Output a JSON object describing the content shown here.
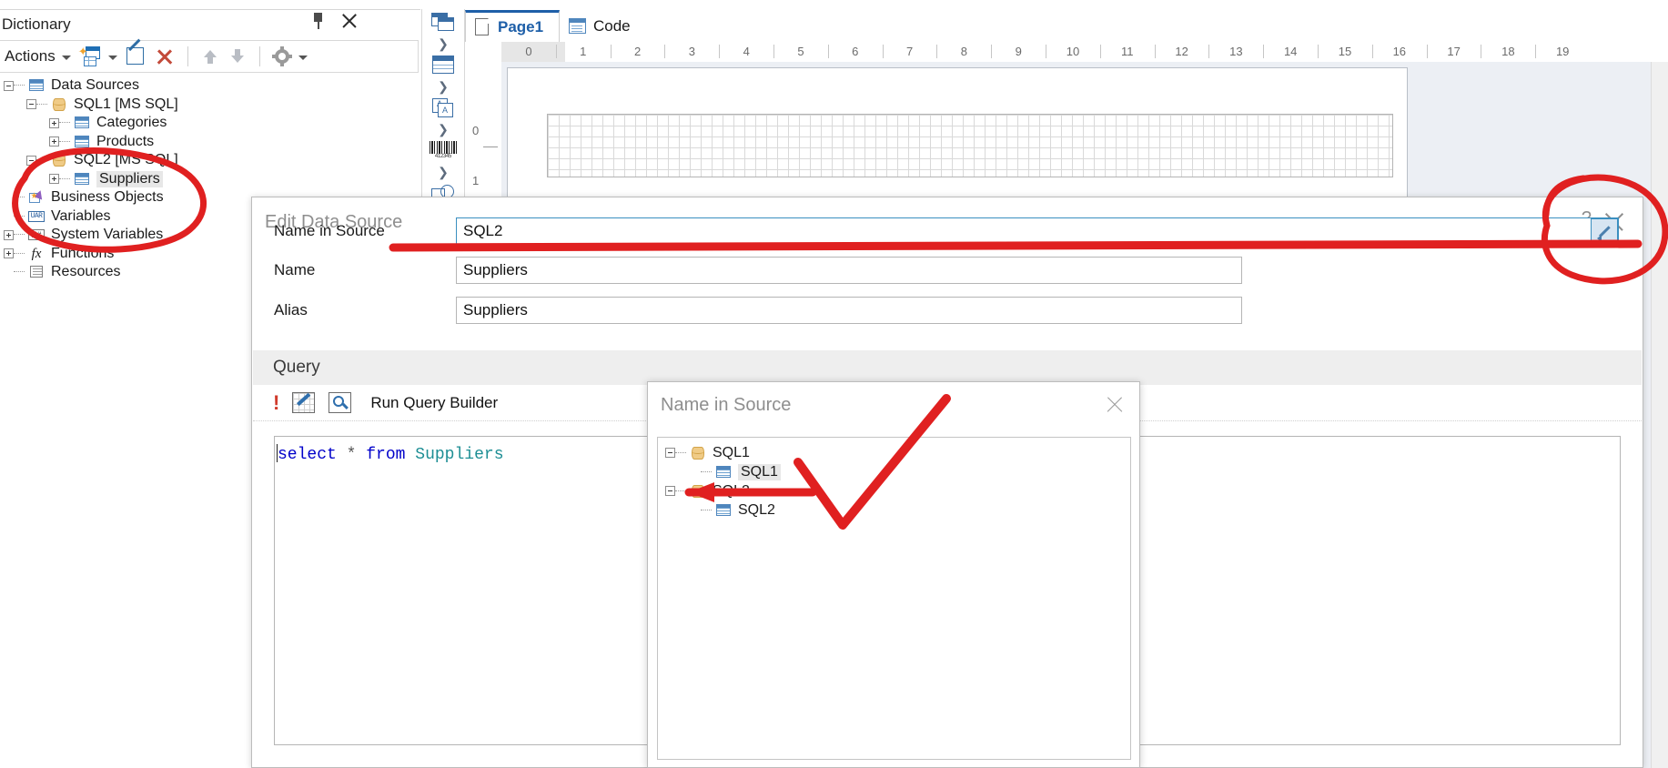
{
  "dictionary": {
    "title": "Dictionary",
    "pin_icon": "pin-icon",
    "close_icon": "close-icon",
    "toolbar": {
      "actions_label": "Actions",
      "new_item_icon": "new-data-source-icon",
      "edit_icon": "edit-icon",
      "delete_icon": "delete-icon",
      "move_up_icon": "arrow-up-icon",
      "move_down_icon": "arrow-down-icon",
      "settings_icon": "gear-icon"
    },
    "tree": [
      {
        "label": "Data Sources",
        "indent": 0,
        "expander": "minus",
        "icon": "table-icon",
        "selected": false
      },
      {
        "label": "SQL1 [MS SQL]",
        "indent": 1,
        "expander": "minus",
        "icon": "database-icon",
        "selected": false
      },
      {
        "label": "Categories",
        "indent": 2,
        "expander": "plus",
        "icon": "table-icon",
        "selected": false
      },
      {
        "label": "Products",
        "indent": 2,
        "expander": "plus",
        "icon": "table-icon",
        "selected": false
      },
      {
        "label": "SQL2 [MS SQL]",
        "indent": 1,
        "expander": "minus",
        "icon": "database-icon",
        "selected": false
      },
      {
        "label": "Suppliers",
        "indent": 2,
        "expander": "plus",
        "icon": "table-icon",
        "selected": true
      },
      {
        "label": "Business Objects",
        "indent": 0,
        "expander": "none",
        "icon": "business-objects-icon",
        "selected": false
      },
      {
        "label": "Variables",
        "indent": 0,
        "expander": "none",
        "icon": "variables-icon",
        "selected": false
      },
      {
        "label": "System Variables",
        "indent": 0,
        "expander": "plus",
        "icon": "system-variables-icon",
        "selected": false
      },
      {
        "label": "Functions",
        "indent": 0,
        "expander": "plus",
        "icon": "functions-icon",
        "selected": false
      },
      {
        "label": "Resources",
        "indent": 0,
        "expander": "none",
        "icon": "resources-icon",
        "selected": false
      }
    ]
  },
  "component_strip": {
    "items": [
      {
        "icon": "panels-icon",
        "chevron": "chevron-right-icon"
      },
      {
        "icon": "data-band-icon",
        "chevron": "chevron-right-icon"
      },
      {
        "icon": "text-icon",
        "chevron": "chevron-right-icon"
      },
      {
        "icon": "barcode-icon",
        "chevron": "chevron-right-icon"
      },
      {
        "icon": "shapes-icon",
        "chevron": ""
      }
    ]
  },
  "tabs": [
    {
      "label": "Page1",
      "icon": "page-icon",
      "active": true
    },
    {
      "label": "Code",
      "icon": "code-icon",
      "active": false
    }
  ],
  "ruler": {
    "horizontal": [
      "0",
      "1",
      "2",
      "3",
      "4",
      "5",
      "6",
      "7",
      "8",
      "9",
      "10",
      "11",
      "12",
      "13",
      "14",
      "15",
      "16",
      "17",
      "18",
      "19"
    ],
    "vertical": [
      "0",
      "1"
    ]
  },
  "edit_data_source_dialog": {
    "title": "Edit Data Source",
    "help_label": "?",
    "close_icon": "close-icon",
    "fields": [
      {
        "label": "Name in Source",
        "value": "SQL2",
        "focused": true,
        "has_browse": true
      },
      {
        "label": "Name",
        "value": "Suppliers",
        "focused": false,
        "has_browse": false
      },
      {
        "label": "Alias",
        "value": "Suppliers",
        "focused": false,
        "has_browse": false
      }
    ],
    "browse_icon": "pencil-icon",
    "query": {
      "section_label": "Query",
      "error_icon": "exclamation-icon",
      "edit_query_icon": "edit-query-icon",
      "preview_icon": "preview-query-icon",
      "run_query_builder_label": "Run Query Builder",
      "sql_tokens": [
        {
          "text": "select",
          "type": "keyword"
        },
        {
          "text": " ",
          "type": "plain"
        },
        {
          "text": "*",
          "type": "operator"
        },
        {
          "text": " ",
          "type": "plain"
        },
        {
          "text": "from",
          "type": "keyword"
        },
        {
          "text": " ",
          "type": "plain"
        },
        {
          "text": "Suppliers",
          "type": "table"
        }
      ],
      "sql_text": "select * from Suppliers"
    }
  },
  "name_in_source_popup": {
    "title": "Name in Source",
    "close_icon": "close-icon",
    "tree": [
      {
        "label": "SQL1",
        "indent": 0,
        "expander": "minus",
        "icon": "database-icon",
        "selected": false
      },
      {
        "label": "SQL1",
        "indent": 1,
        "expander": "none",
        "icon": "table-icon",
        "selected": true
      },
      {
        "label": "SQL2",
        "indent": 0,
        "expander": "minus",
        "icon": "database-icon",
        "selected": false
      },
      {
        "label": "SQL2",
        "indent": 1,
        "expander": "none",
        "icon": "table-icon",
        "selected": false
      }
    ]
  },
  "annotations": {
    "color": "#e02020",
    "marks": [
      {
        "name": "ellipse-around-sql2-node",
        "shape": "ellipse"
      },
      {
        "name": "underline-name-in-source-field",
        "shape": "line"
      },
      {
        "name": "ellipse-around-browse-button",
        "shape": "ellipse"
      },
      {
        "name": "arrow-to-sql2-popup-node",
        "shape": "arrow"
      },
      {
        "name": "checkmark-popup",
        "shape": "check"
      }
    ]
  }
}
